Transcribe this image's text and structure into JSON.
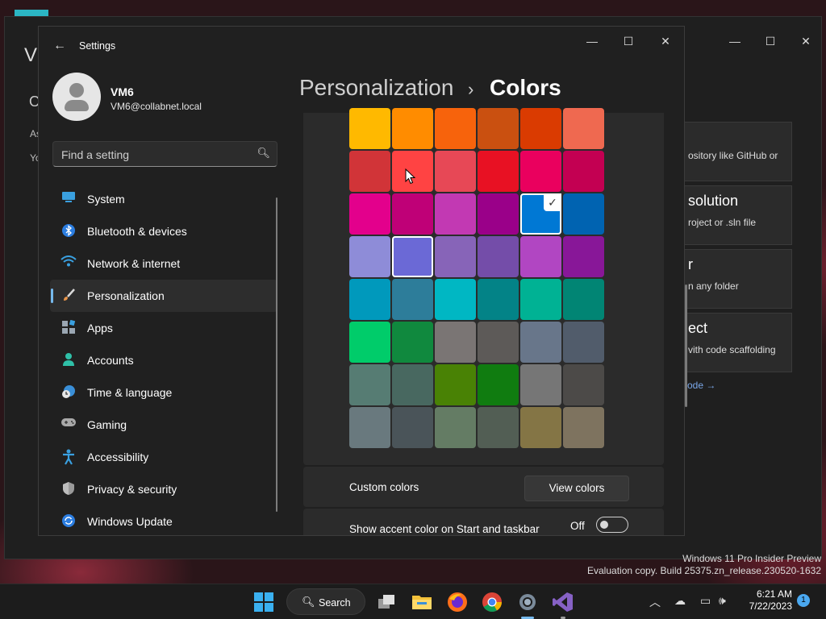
{
  "desktop": {
    "watermark_line1": "Windows 11 Pro Insider Preview",
    "watermark_line2": "Evaluation copy. Build 25375.zn_release.230520-1632"
  },
  "vs_window": {
    "title": "Vi",
    "left_letter": "O",
    "left_line1": "As",
    "left_line2": "Yo",
    "cards": [
      {
        "title": "",
        "subtitle": "ository like GitHub or"
      },
      {
        "title": "solution",
        "subtitle": "roject or .sln file"
      },
      {
        "title": "r",
        "subtitle": "n any folder"
      },
      {
        "title": "ect",
        "subtitle": "vith code scaffolding"
      }
    ],
    "link": "ode →"
  },
  "settings": {
    "app_title": "Settings",
    "user": {
      "name": "VM6",
      "email": "VM6@collabnet.local"
    },
    "search_placeholder": "Find a setting",
    "nav": [
      {
        "label": "System",
        "icon": "monitor-icon",
        "active": false
      },
      {
        "label": "Bluetooth & devices",
        "icon": "bluetooth-icon",
        "active": false
      },
      {
        "label": "Network & internet",
        "icon": "wifi-icon",
        "active": false
      },
      {
        "label": "Personalization",
        "icon": "paintbrush-icon",
        "active": true
      },
      {
        "label": "Apps",
        "icon": "apps-icon",
        "active": false
      },
      {
        "label": "Accounts",
        "icon": "person-icon",
        "active": false
      },
      {
        "label": "Time & language",
        "icon": "globe-clock-icon",
        "active": false
      },
      {
        "label": "Gaming",
        "icon": "gamepad-icon",
        "active": false
      },
      {
        "label": "Accessibility",
        "icon": "accessibility-icon",
        "active": false
      },
      {
        "label": "Privacy & security",
        "icon": "shield-icon",
        "active": false
      },
      {
        "label": "Windows Update",
        "icon": "refresh-icon",
        "active": false
      }
    ],
    "breadcrumb_parent": "Personalization",
    "breadcrumb_sep": "›",
    "breadcrumb_current": "Colors",
    "accent_colors": [
      [
        "#FFB900",
        "#FF8C00",
        "#F7630C",
        "#CA5010",
        "#DA3B01",
        "#EF6950"
      ],
      [
        "#D13438",
        "#FF4343",
        "#E74856",
        "#E81123",
        "#EA005E",
        "#C30052"
      ],
      [
        "#E3008C",
        "#BF0077",
        "#C239B3",
        "#9A0089",
        "#0078D4",
        "#0063B1"
      ],
      [
        "#8E8CD8",
        "#6B69D6",
        "#8764B8",
        "#744DA9",
        "#B146C2",
        "#881798"
      ],
      [
        "#0099BC",
        "#2D7D9A",
        "#00B7C3",
        "#038387",
        "#00B294",
        "#018574"
      ],
      [
        "#00CC6A",
        "#10893E",
        "#7A7574",
        "#5D5A58",
        "#68768A",
        "#515C6B"
      ],
      [
        "#567C73",
        "#486860",
        "#498205",
        "#107C10",
        "#767676",
        "#4C4A48"
      ],
      [
        "#69797E",
        "#4A5459",
        "#647C64",
        "#525E54",
        "#847545",
        "#7E735F"
      ]
    ],
    "selected_color": "#0078D4",
    "custom_colors_label": "Custom colors",
    "view_colors_button": "View colors",
    "show_accent_label": "Show accent color on Start and taskbar",
    "show_accent_state": "Off"
  },
  "taskbar": {
    "search_label": "Search",
    "time": "6:21 AM",
    "date": "7/22/2023",
    "notification_count": "1",
    "apps": [
      "windows-start-icon",
      "task-view-icon",
      "file-explorer-icon",
      "firefox-icon",
      "chrome-icon",
      "settings-icon",
      "visual-studio-icon"
    ]
  }
}
